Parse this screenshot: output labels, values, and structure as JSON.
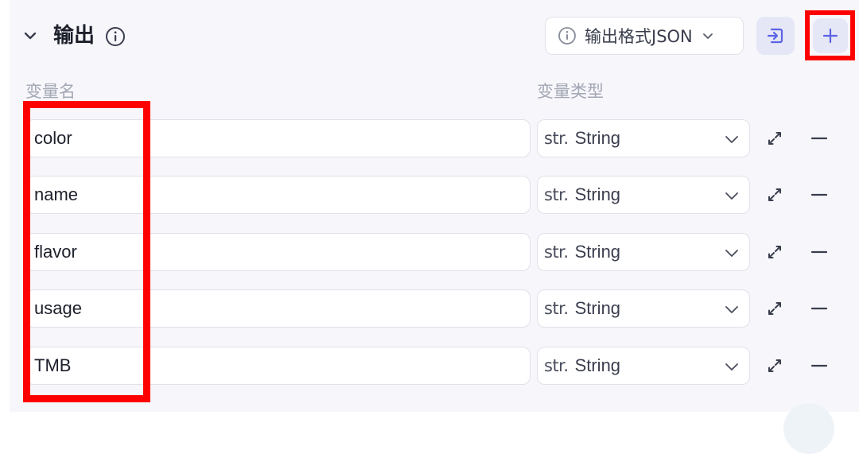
{
  "section": {
    "title": "输出",
    "collapse_icon": "chevron-down-icon",
    "info_icon": "info-circle-icon"
  },
  "format_select": {
    "label": "输出格式JSON",
    "icon": "info-circle-icon",
    "chevron": "chevron-down-icon"
  },
  "import_button": {
    "icon": "import-icon"
  },
  "add_button": {
    "icon": "plus-icon"
  },
  "columns": {
    "name": "变量名",
    "type": "变量类型"
  },
  "rows": [
    {
      "name": "color",
      "type_tag": "str.",
      "type": "String"
    },
    {
      "name": "name",
      "type_tag": "str.",
      "type": "String"
    },
    {
      "name": "flavor",
      "type_tag": "str.",
      "type": "String"
    },
    {
      "name": "usage",
      "type_tag": "str.",
      "type": "String"
    },
    {
      "name": "TMB",
      "type_tag": "str.",
      "type": "String"
    }
  ],
  "colors": {
    "highlight": "#ff0000",
    "accent": "#5b63e6",
    "panel_bg": "#f7f7fb"
  }
}
